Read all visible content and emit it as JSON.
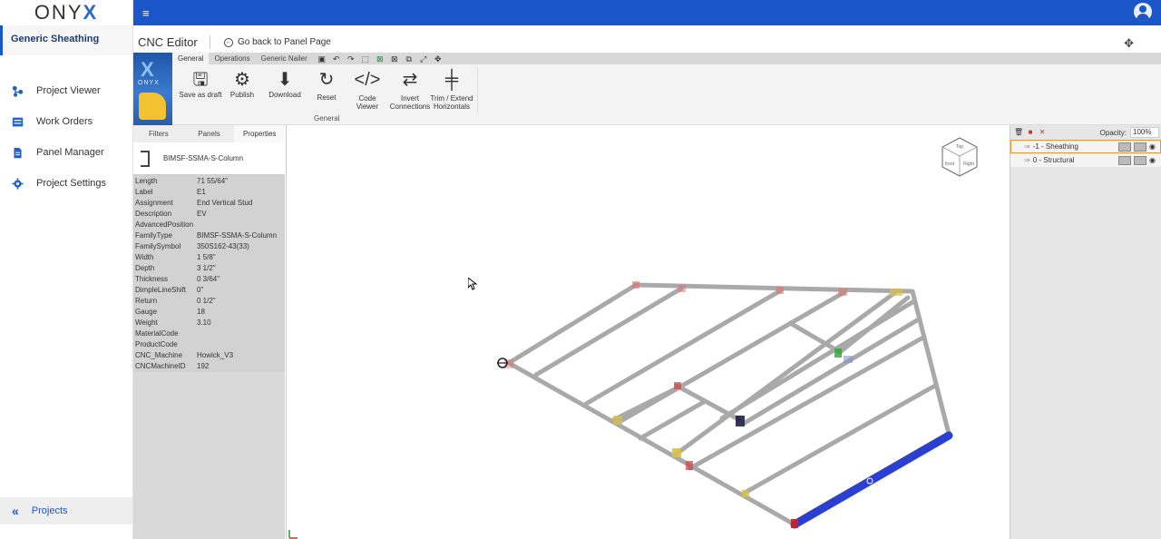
{
  "app": {
    "logo_text": "ONY",
    "logo_x": "X"
  },
  "sidebar": {
    "active_project": "Generic Sheathing",
    "items": [
      {
        "label": "Project Viewer",
        "icon": "sitemap-icon"
      },
      {
        "label": "Work Orders",
        "icon": "work-orders-icon"
      },
      {
        "label": "Panel Manager",
        "icon": "document-icon"
      },
      {
        "label": "Project Settings",
        "icon": "gear-icon"
      }
    ],
    "projects_label": "Projects"
  },
  "header": {
    "title": "CNC Editor",
    "back_label": "Go back to Panel Page"
  },
  "ribbon": {
    "tabs": [
      "General",
      "Operations",
      "Generic Nailer"
    ],
    "buttons": [
      {
        "label1": "Save as draft",
        "label2": ""
      },
      {
        "label1": "Publish",
        "label2": ""
      },
      {
        "label1": "Download",
        "label2": ""
      },
      {
        "label1": "Reset",
        "label2": ""
      },
      {
        "label1": "Code",
        "label2": "Viewer"
      },
      {
        "label1": "Invert",
        "label2": "Connections"
      },
      {
        "label1": "Trim / Extend",
        "label2": "Horizontals"
      }
    ],
    "group_label": "General"
  },
  "panel": {
    "tabs": [
      "Filters",
      "Panels",
      "Properties"
    ],
    "header_name": "BIMSF-SSMA-S-Column",
    "properties": [
      {
        "k": "Length",
        "v": "71 55/64\""
      },
      {
        "k": "Label",
        "v": "E1"
      },
      {
        "k": "Assignment",
        "v": "End Vertical Stud"
      },
      {
        "k": "Description",
        "v": "EV"
      },
      {
        "k": "AdvancedPosition",
        "v": ""
      },
      {
        "k": "FamilyType",
        "v": "BIMSF-SSMA-S-Column"
      },
      {
        "k": "FamilySymbol",
        "v": "350S162-43(33)"
      },
      {
        "k": "Width",
        "v": "1 5/8\""
      },
      {
        "k": "Depth",
        "v": "3 1/2\""
      },
      {
        "k": "Thickness",
        "v": "0 3/64\""
      },
      {
        "k": "DimpleLineShift",
        "v": "0\""
      },
      {
        "k": "Return",
        "v": "0 1/2\""
      },
      {
        "k": "Gauge",
        "v": "18"
      },
      {
        "k": "Weight",
        "v": "3.10"
      },
      {
        "k": "MaterialCode",
        "v": ""
      },
      {
        "k": "ProductCode",
        "v": ""
      },
      {
        "k": "CNC_Machine",
        "v": "Howick_V3"
      },
      {
        "k": "CNCMachineID",
        "v": "192"
      }
    ]
  },
  "layers": {
    "opacity_label": "Opacity:",
    "opacity_value": "100%",
    "rows": [
      {
        "label": "-1 - Sheathing"
      },
      {
        "label": "0 - Structural"
      }
    ]
  },
  "viewport": {
    "cube_faces": {
      "top": "Top",
      "front": "front",
      "right": "Right"
    }
  },
  "colors": {
    "brand": "#1a56c8",
    "selected_member": "#2b3fd1",
    "layer_highlight": "#e3953b"
  }
}
